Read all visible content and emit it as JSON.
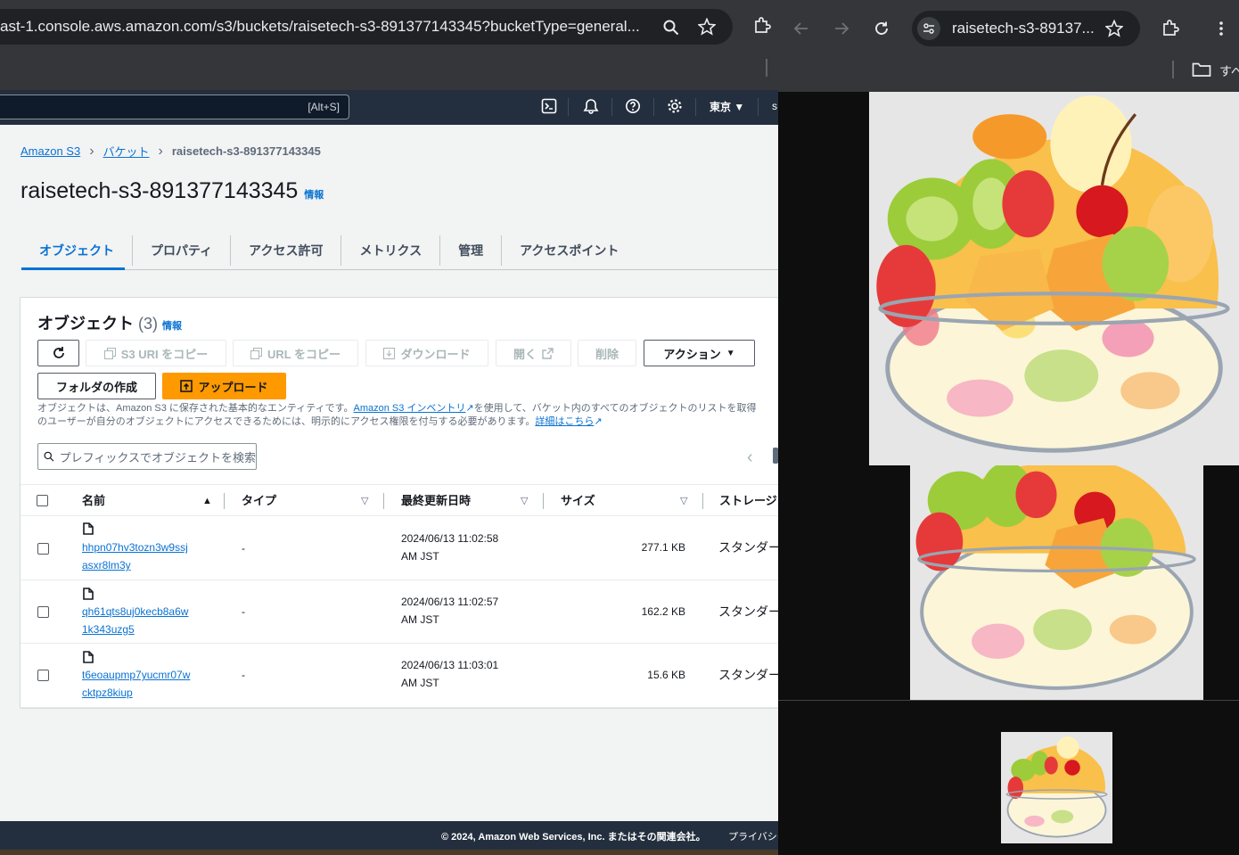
{
  "browser_left": {
    "url": "ast-1.console.aws.amazon.com/s3/buckets/raisetech-s3-891377143345?bucketType=general..."
  },
  "aws_nav": {
    "search_shortcut": "[Alt+S]",
    "region": "東京 ▼",
    "extra": "s"
  },
  "breadcrumb": {
    "items": [
      "Amazon S3",
      "バケット"
    ],
    "current": "raisetech-s3-891377143345"
  },
  "page": {
    "title": "raisetech-s3-891377143345",
    "info": "情報"
  },
  "tabs": [
    "オブジェクト",
    "プロパティ",
    "アクセス許可",
    "メトリクス",
    "管理",
    "アクセスポイント"
  ],
  "objects_panel": {
    "title": "オブジェクト",
    "count": "(3)",
    "info": "情報",
    "buttons": {
      "copy_s3_uri": "S3 URI をコピー",
      "copy_url": "URL をコピー",
      "download": "ダウンロード",
      "open": "開く",
      "delete": "削除",
      "actions": "アクション",
      "create_folder": "フォルダの作成",
      "upload": "アップロード"
    },
    "description": {
      "part1": "オブジェクトは、Amazon S3 に保存された基本的なエンティティです。",
      "link1": "Amazon S3 インベントリ",
      "part2": "を使用して、バケット内のすべてのオブジェクトのリストを取得",
      "part3": "のユーザーが自分のオブジェクトにアクセスできるためには、明示的にアクセス権限を付与する必要があります。",
      "link2": "詳細はこちら"
    },
    "filter_placeholder": "プレフィックスでオブジェクトを検索",
    "columns": [
      "名前",
      "タイプ",
      "最終更新日時",
      "サイズ",
      "ストレージ"
    ],
    "rows": [
      {
        "name1": "hhpn07hv3tozn3w9ssj",
        "name2": "asxr8lm3y",
        "type": "-",
        "date1": "2024/06/13 11:02:58",
        "date2": "AM JST",
        "size": "277.1 KB",
        "storage": "スタンダード"
      },
      {
        "name1": "qh61qts8uj0kecb8a6w",
        "name2": "1k343uzg5",
        "type": "-",
        "date1": "2024/06/13 11:02:57",
        "date2": "AM JST",
        "size": "162.2 KB",
        "storage": "スタンダード"
      },
      {
        "name1": "t6eoaupmp7yucmr07w",
        "name2": "cktpz8kiup",
        "type": "-",
        "date1": "2024/06/13 11:03:01",
        "date2": "AM JST",
        "size": "15.6 KB",
        "storage": "スタンダード"
      }
    ]
  },
  "footer": {
    "copyright": "© 2024, Amazon Web Services, Inc. またはその関連会社。",
    "privacy": "プライバシー"
  },
  "browser_right": {
    "tab_title": "raisetech-s3-89137...",
    "bookmark": "すべ"
  }
}
